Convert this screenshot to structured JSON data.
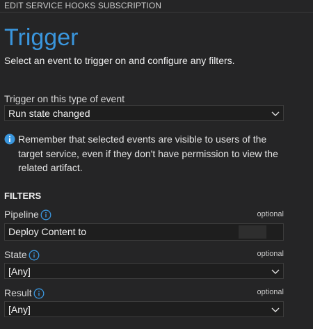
{
  "window": {
    "title": "EDIT SERVICE HOOKS SUBSCRIPTION"
  },
  "page": {
    "heading": "Trigger",
    "subtitle": "Select an event to trigger on and configure any filters."
  },
  "event": {
    "label": "Trigger on this type of event",
    "value": "Run state changed"
  },
  "info": {
    "message": "Remember that selected events are visible to users of the target service, even if they don't have permission to view the related artifact."
  },
  "filters": {
    "heading": "FILTERS",
    "pipeline": {
      "label": "Pipeline",
      "optional": "optional",
      "value": "Deploy Content to"
    },
    "state": {
      "label": "State",
      "optional": "optional",
      "value": "[Any]"
    },
    "result": {
      "label": "Result",
      "optional": "optional",
      "value": "[Any]"
    }
  },
  "colors": {
    "accent": "#3a96dd",
    "background": "#252526",
    "input": "#1e1e1e"
  }
}
